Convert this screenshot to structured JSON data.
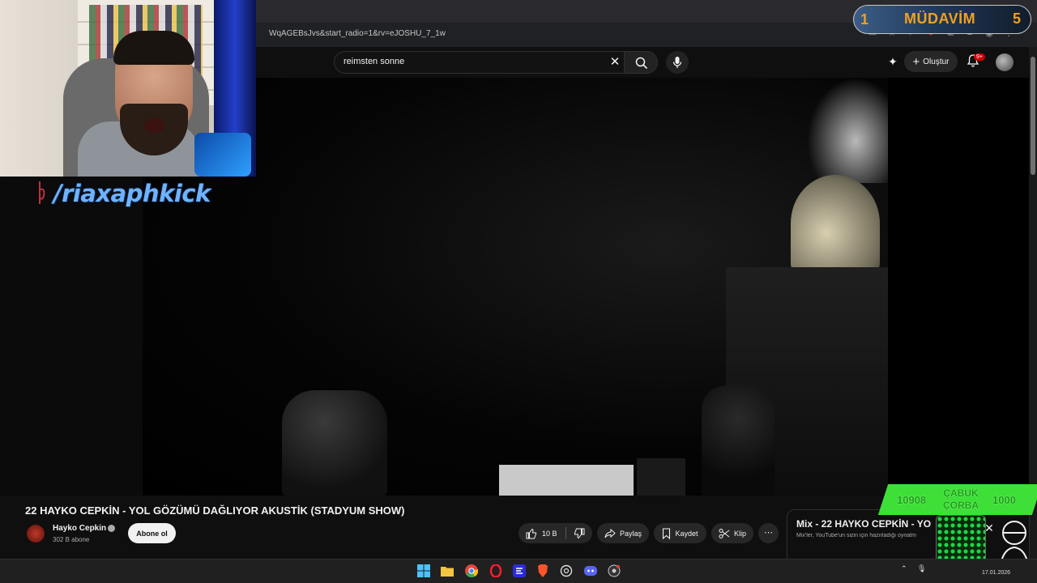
{
  "browser": {
    "url": "WqAGEBsJvs&start_radio=1&rv=eJOSHU_7_1w"
  },
  "youtube": {
    "search": {
      "query": "reimsten sonne"
    },
    "create_label": "Oluştur",
    "notification_badge": "9+"
  },
  "overlay": {
    "kick_handle": "/riaxaphkick",
    "loyalty": {
      "left": "1",
      "title": "MÜDAVİM",
      "right": "5"
    },
    "chat_widget": {
      "left_count": "10908",
      "label": "ÇABUK ÇORBA",
      "right_count": "1000"
    }
  },
  "video": {
    "title": "22 HAYKO CEPKİN - YOL GÖZÜMÜ DAĞLIYOR AKUSTİK (STADYUM SHOW)",
    "channel_name": "Hayko Cepkin",
    "subscriber_count": "302 B abone",
    "subscribe_label": "Abone ol",
    "like_count": "10 B",
    "share_label": "Paylaş",
    "save_label": "Kaydet",
    "clip_label": "Klip"
  },
  "mix": {
    "title": "Mix - 22 HAYKO CEPKİN - YO",
    "subtitle": "Mix'ler, YouTube'un sizin için hazırladığı oynatm"
  },
  "taskbar": {
    "date": "17.01.2026"
  }
}
